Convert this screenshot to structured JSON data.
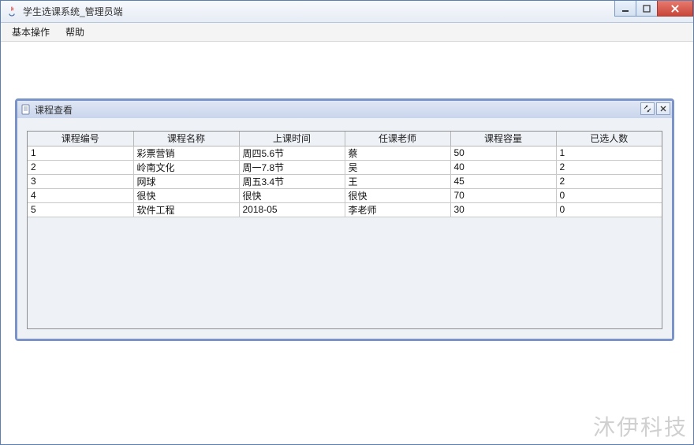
{
  "window": {
    "title": "学生选课系统_管理员端"
  },
  "menubar": {
    "items": [
      "基本操作",
      "帮助"
    ]
  },
  "internal_frame": {
    "title": "课程查看"
  },
  "table": {
    "headers": [
      "课程编号",
      "课程名称",
      "上课时间",
      "任课老师",
      "课程容量",
      "已选人数"
    ],
    "rows": [
      {
        "id": "1",
        "name": "彩票营销",
        "time": "周四5.6节",
        "teacher": "蔡",
        "capacity": "50",
        "enrolled": "1"
      },
      {
        "id": "2",
        "name": "岭南文化",
        "time": "周一7.8节",
        "teacher": "吴",
        "capacity": "40",
        "enrolled": "2"
      },
      {
        "id": "3",
        "name": "网球",
        "time": "周五3.4节",
        "teacher": "王",
        "capacity": "45",
        "enrolled": "2"
      },
      {
        "id": "4",
        "name": "很快",
        "time": "很快",
        "teacher": "很快",
        "capacity": "70",
        "enrolled": "0"
      },
      {
        "id": "5",
        "name": "软件工程",
        "time": "2018-05",
        "teacher": "李老师",
        "capacity": "30",
        "enrolled": "0"
      }
    ]
  },
  "watermark": "沐伊科技"
}
